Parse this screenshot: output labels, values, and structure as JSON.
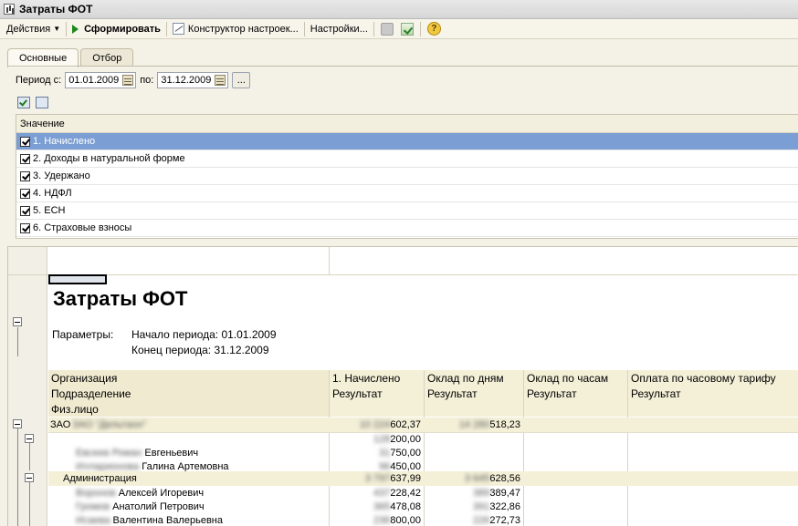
{
  "window": {
    "title": "Затраты ФОТ"
  },
  "toolbar": {
    "actions_label": "Действия",
    "generate_label": "Сформировать",
    "constructor_label": "Конструктор настроек...",
    "settings_label": "Настройки..."
  },
  "tabs": [
    {
      "label": "Основные",
      "active": true
    },
    {
      "label": "Отбор",
      "active": false
    }
  ],
  "period": {
    "from_label": "Период с:",
    "from_value": "01.01.2009",
    "to_label": "по:",
    "to_value": "31.12.2009",
    "more_label": "..."
  },
  "values_table": {
    "header": "Значение",
    "rows": [
      {
        "label": "1. Начислено",
        "checked": true,
        "selected": true
      },
      {
        "label": "2. Доходы в натуральной форме",
        "checked": true
      },
      {
        "label": "3. Удержано",
        "checked": true
      },
      {
        "label": "4. НДФЛ",
        "checked": true
      },
      {
        "label": "5. ЕСН",
        "checked": true
      },
      {
        "label": "6. Страховые взносы",
        "checked": true
      }
    ]
  },
  "report": {
    "title": "Затраты ФОТ",
    "params_label": "Параметры:",
    "period_start": "Начало периода: 01.01.2009",
    "period_end": "Конец периода: 31.12.2009",
    "row_headers": [
      "Организация",
      "Подразделение",
      "Физ.лицо"
    ],
    "col_headers": [
      {
        "name": "1. Начислено",
        "sub": "Результат"
      },
      {
        "name": "Оклад по дням",
        "sub": "Результат"
      },
      {
        "name": "Оклад по часам",
        "sub": "Результат"
      },
      {
        "name": "Оплата по часовому тарифу",
        "sub": "Результат"
      }
    ],
    "rows": [
      {
        "name_hidden": "ЗАО \"Дельтаон\"",
        "name_visible": "ЗАО",
        "c1_hidden": "10 224",
        "c1_visible": "602,37",
        "c2_hidden": "14 280",
        "c2_visible": "518,23"
      },
      {
        "name_hidden": "",
        "name_visible": "",
        "c1_hidden": "128",
        "c1_visible": "200,00",
        "c2_hidden": "",
        "c2_visible": ""
      },
      {
        "name_hidden": "Евсеев Роман",
        "name_visible": "Евгеньевич",
        "c1_hidden": "31",
        "c1_visible": "750,00",
        "c2_hidden": "",
        "c2_visible": ""
      },
      {
        "name_hidden": "Илларионова",
        "name_visible": "Галина Артемовна",
        "c1_hidden": "96",
        "c1_visible": "450,00",
        "c2_hidden": "",
        "c2_visible": ""
      },
      {
        "name_hidden": "",
        "name_visible": "Администрация",
        "c1_hidden": "3 797",
        "c1_visible": "637,99",
        "c2_hidden": "3 645",
        "c2_visible": "628,56"
      },
      {
        "name_hidden": "Воронов",
        "name_visible": "Алексей Игоревич",
        "c1_hidden": "437",
        "c1_visible": "228,42",
        "c2_hidden": "389",
        "c2_visible": "389,47"
      },
      {
        "name_hidden": "Громов",
        "name_visible": "Анатолий Петрович",
        "c1_hidden": "365",
        "c1_visible": "478,08",
        "c2_hidden": "391",
        "c2_visible": "322,86"
      },
      {
        "name_hidden": "Исаева",
        "name_visible": "Валентина Валерьевна",
        "c1_hidden": "236",
        "c1_visible": "800,00",
        "c2_hidden": "226",
        "c2_visible": "272,73"
      }
    ]
  }
}
